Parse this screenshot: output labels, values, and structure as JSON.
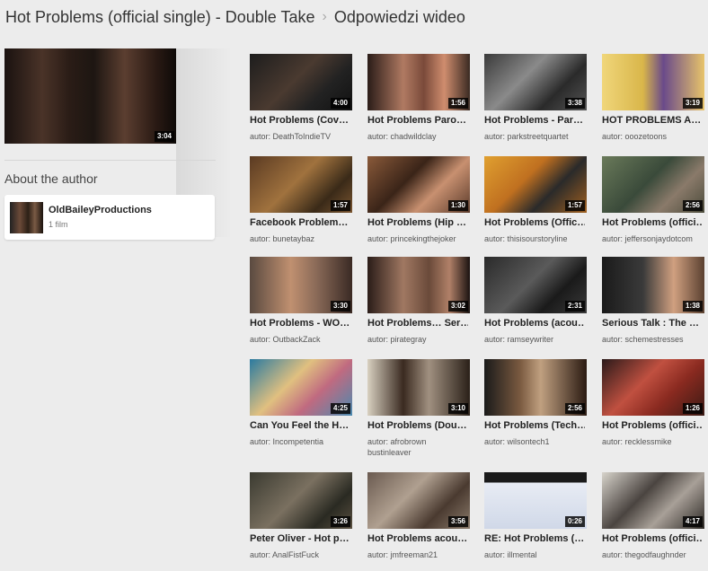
{
  "header": {
    "title": "Hot Problems (official single) - Double Take",
    "separator": "›",
    "section": "Odpowiedzi wideo"
  },
  "main_video": {
    "duration": "3:04"
  },
  "about": {
    "heading": "About the author",
    "author_name": "OldBaileyProductions",
    "film_count": "1 film"
  },
  "videos": [
    {
      "title": "Hot Problems (Cov…",
      "author": "autor: DeathToIndieTV",
      "duration": "4:00"
    },
    {
      "title": "Hot Problems Paro…",
      "author": "autor: chadwildclay",
      "duration": "1:56"
    },
    {
      "title": "Hot Problems - Par…",
      "author": "autor: parkstreetquartet",
      "duration": "3:38"
    },
    {
      "title": "HOT PROBLEMS A…",
      "author": "autor: ooozetoons",
      "duration": "3:19"
    },
    {
      "title": "Facebook Problem…",
      "author": "autor: bunetaybaz",
      "duration": "1:57"
    },
    {
      "title": "Hot Problems (Hip …",
      "author": "autor: princekingthejoker",
      "duration": "1:30"
    },
    {
      "title": "Hot Problems (Offic…",
      "author": "autor: thisisourstoryline",
      "duration": "1:57"
    },
    {
      "title": "Hot Problems (offici…",
      "author": "autor: jeffersonjaydotcom",
      "duration": "2:56"
    },
    {
      "title": "Hot Problems - WO…",
      "author": "autor: OutbackZack",
      "duration": "3:30"
    },
    {
      "title": "Hot Problems… Ser…",
      "author": "autor: pirategray",
      "duration": "3:02"
    },
    {
      "title": "Hot Problems (acou…",
      "author": "autor: ramseywriter",
      "duration": "2:31"
    },
    {
      "title": "Serious Talk : The …",
      "author": "autor: schemestresses",
      "duration": "1:38"
    },
    {
      "title": "Can You Feel the H…",
      "author": "autor: Incompetentia",
      "duration": "4:25"
    },
    {
      "title": "Hot Problems (Dou…",
      "author": "autor: afrobrown bustinleaver",
      "duration": "3:10"
    },
    {
      "title": "Hot Problems (Tech…",
      "author": "autor: wilsontech1",
      "duration": "2:56"
    },
    {
      "title": "Hot Problems (offici…",
      "author": "autor: recklessmike",
      "duration": "1:26"
    },
    {
      "title": "Peter Oliver - Hot p…",
      "author": "autor: AnalFistFuck",
      "duration": "3:26"
    },
    {
      "title": "Hot Problems acou…",
      "author": "autor: jmfreeman21",
      "duration": "3:56"
    },
    {
      "title": "RE: Hot Problems (…",
      "author": "autor: illmental",
      "duration": "0:26"
    },
    {
      "title": "Hot Problems (offici…",
      "author": "autor: thegodfaughnder",
      "duration": "4:17"
    }
  ]
}
